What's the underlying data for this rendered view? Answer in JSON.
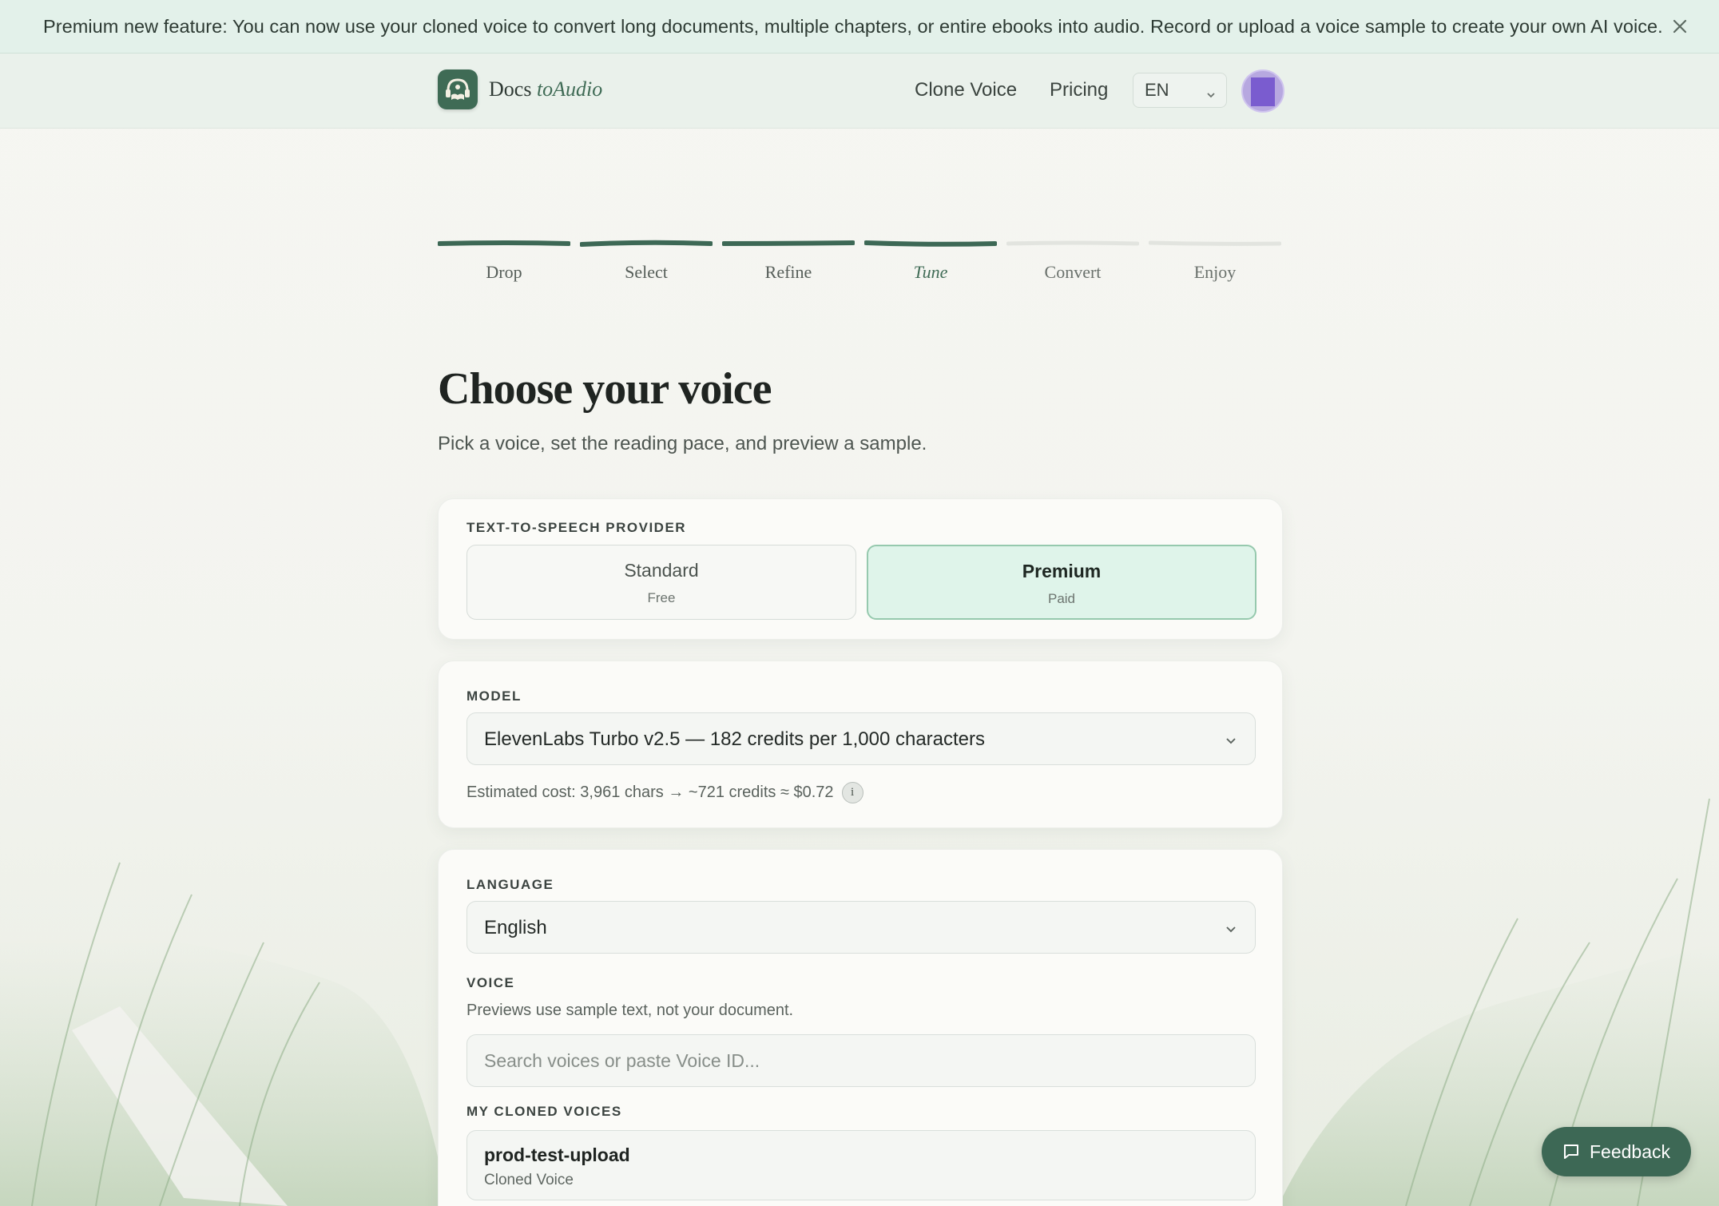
{
  "banner": {
    "text": "Premium new feature: You can now use your cloned voice to convert long documents, multiple chapters, or entire ebooks into audio. Record or upload a voice sample to create your own AI voice.",
    "close_icon": "close-icon"
  },
  "header": {
    "logo_icon": "headphones-book-icon",
    "logo_word1": "Docs ",
    "logo_word2": "to",
    "logo_word3": "Audio",
    "nav": {
      "clone_voice": "Clone Voice",
      "pricing": "Pricing"
    },
    "language": "EN"
  },
  "stepper": {
    "steps": [
      {
        "label": "Drop",
        "state": "done"
      },
      {
        "label": "Select",
        "state": "done"
      },
      {
        "label": "Refine",
        "state": "done"
      },
      {
        "label": "Tune",
        "state": "current"
      },
      {
        "label": "Convert",
        "state": "todo"
      },
      {
        "label": "Enjoy",
        "state": "todo"
      }
    ]
  },
  "page": {
    "title": "Choose your voice",
    "subtitle": "Pick a voice, set the reading pace, and preview a sample."
  },
  "provider": {
    "label": "TEXT-TO-SPEECH PROVIDER",
    "options": [
      {
        "name": "Standard",
        "sub": "Free",
        "selected": false
      },
      {
        "name": "Premium",
        "sub": "Paid",
        "selected": true
      }
    ]
  },
  "model": {
    "label": "MODEL",
    "value": "ElevenLabs Turbo v2.5 — 182 credits per 1,000 characters",
    "cost": "Estimated cost: 3,961 chars → ~721 credits ≈ $0.72",
    "info_glyph": "i"
  },
  "language": {
    "label": "LANGUAGE",
    "value": "English"
  },
  "voice": {
    "label": "VOICE",
    "helper": "Previews use sample text, not your document.",
    "search_placeholder": "Search voices or paste Voice ID...",
    "cloned_label": "MY CLONED VOICES",
    "cloned": [
      {
        "name": "prod-test-upload",
        "type": "Cloned Voice"
      }
    ]
  },
  "feedback": {
    "label": "Feedback",
    "icon": "chat-bubble-icon"
  },
  "colors": {
    "accent": "#3f6b55",
    "step_done": "#3d6855",
    "step_todo": "#e2e4df",
    "selected_bg": "#dff4ea",
    "banner_bg": "#e3f1ea"
  }
}
